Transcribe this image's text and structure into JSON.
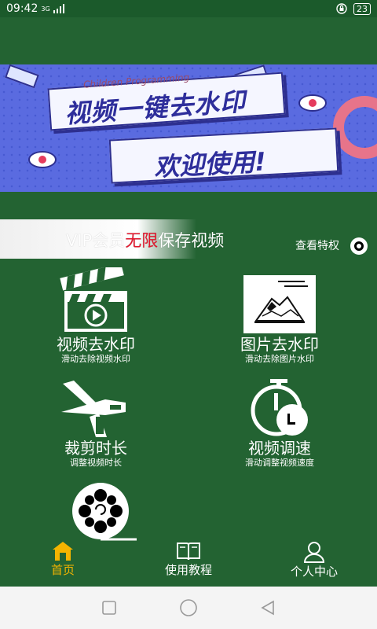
{
  "status_bar": {
    "time": "09:42",
    "network": "3G",
    "battery": "23"
  },
  "banner": {
    "subtitle": "Children Programming",
    "title": "视频一键去水印",
    "welcome": "欢迎使用!"
  },
  "vip": {
    "prefix": "VIP会员",
    "highlight": "无限",
    "suffix": "保存视频",
    "privilege_label": "查看特权"
  },
  "features": [
    {
      "title": "视频去水印",
      "subtitle": "滑动去除视频水印",
      "icon": "clapperboard-play-icon"
    },
    {
      "title": "图片去水印",
      "subtitle": "滑动去除图片水印",
      "icon": "mountain-picture-icon"
    },
    {
      "title": "裁剪时长",
      "subtitle": "调整视频时长",
      "icon": "scissors-icon"
    },
    {
      "title": "视频调速",
      "subtitle": "滑动调整视频速度",
      "icon": "stopwatch-icon"
    },
    {
      "title": "",
      "subtitle": "",
      "icon": "film-reel-icon"
    }
  ],
  "nav": [
    {
      "label": "首页",
      "icon": "home-icon",
      "active": true
    },
    {
      "label": "使用教程",
      "icon": "book-icon",
      "active": false
    },
    {
      "label": "个人中心",
      "icon": "user-icon",
      "active": false
    }
  ],
  "colors": {
    "background": "#236332",
    "accent": "#f4b400",
    "highlight": "#e3152b"
  }
}
